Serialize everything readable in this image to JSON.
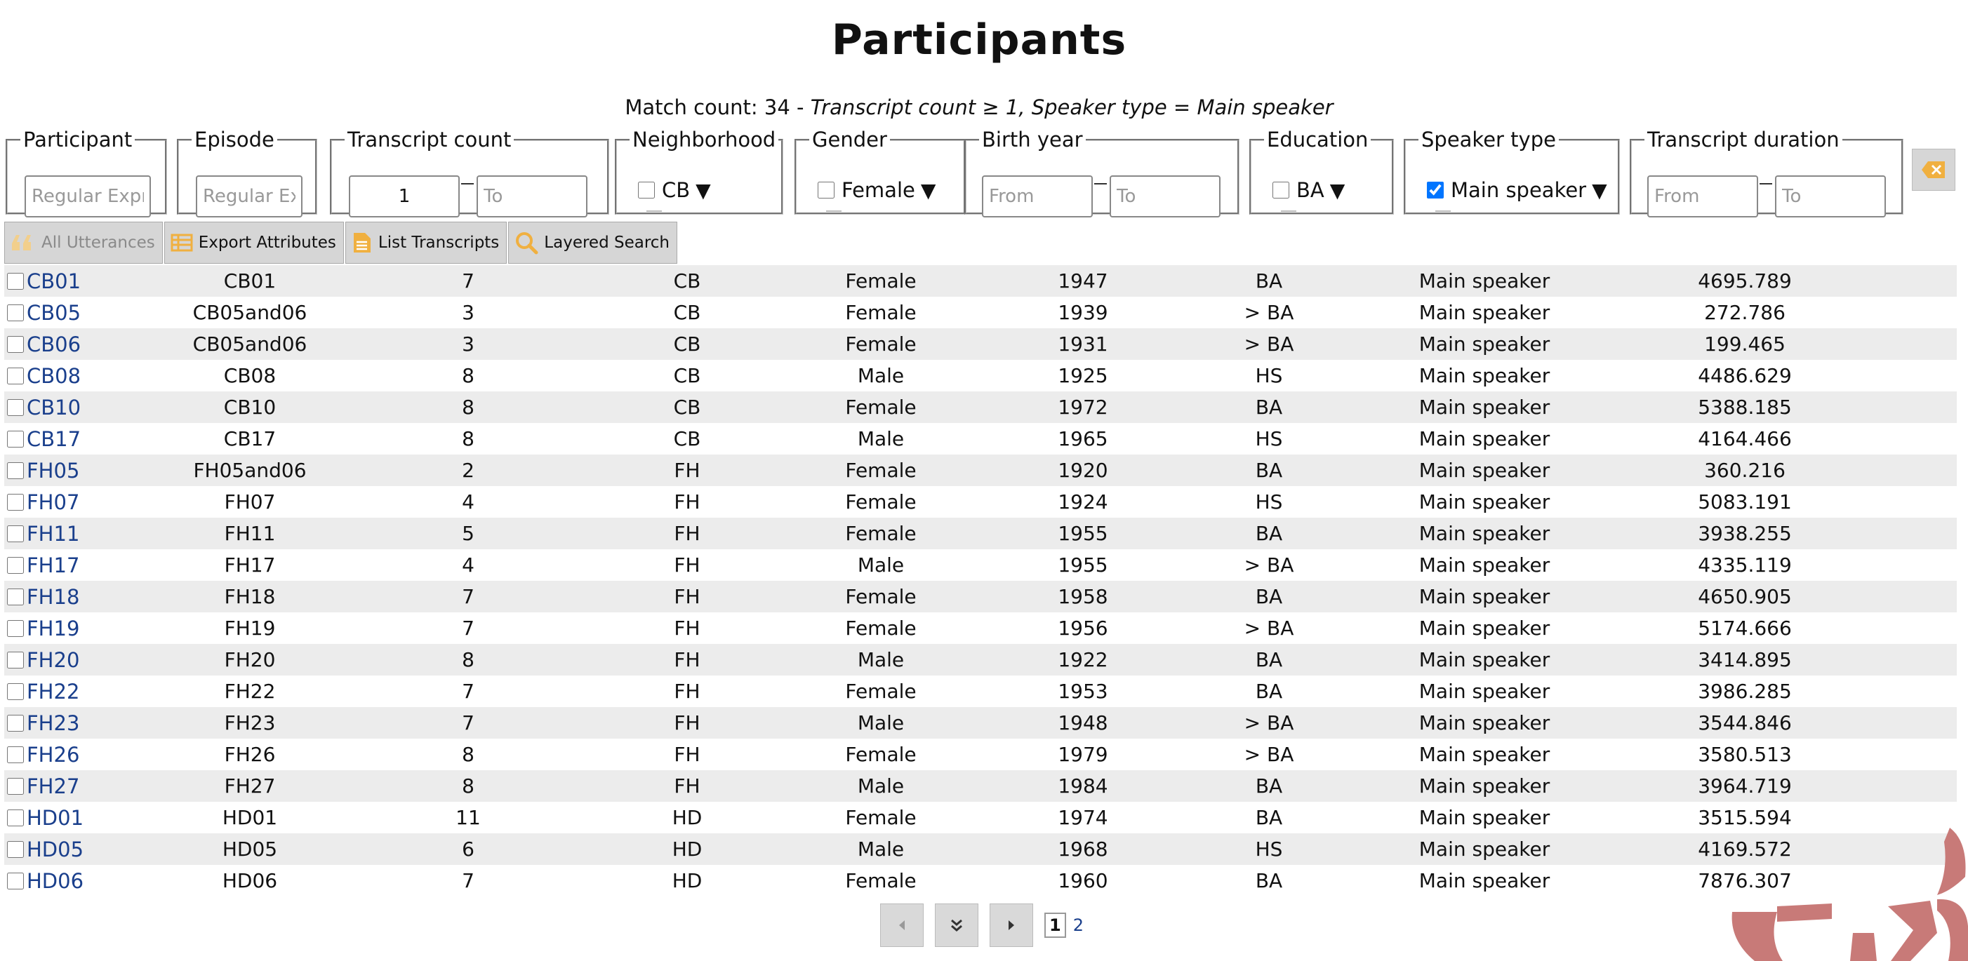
{
  "page": {
    "title": "Participants"
  },
  "match": {
    "prefix": "Match count: 34 - ",
    "criteria": "Transcript count ≥ 1, Speaker type = Main speaker"
  },
  "filters": {
    "participant": {
      "legend": "Participant",
      "placeholder": "Regular Expression"
    },
    "episode": {
      "legend": "Episode",
      "placeholder": "Regular Expression"
    },
    "transcript_count": {
      "legend": "Transcript count",
      "from_value": "1",
      "to_placeholder": "To"
    },
    "neighborhood": {
      "legend": "Neighborhood",
      "option": "CB",
      "checked": false,
      "arrow": "▼"
    },
    "gender": {
      "legend": "Gender",
      "option": "Female",
      "checked": false,
      "arrow": "▼"
    },
    "birth_year": {
      "legend": "Birth year",
      "from_placeholder": "From",
      "to_placeholder": "To"
    },
    "education": {
      "legend": "Education",
      "option": "BA",
      "checked": false,
      "arrow": "▼"
    },
    "speaker_type": {
      "legend": "Speaker type",
      "option": "Main speaker",
      "checked": true,
      "arrow": "▼"
    },
    "transcript_duration": {
      "legend": "Transcript duration",
      "from_placeholder": "From",
      "to_placeholder": "To"
    }
  },
  "toolbar": {
    "all_utterances": "All Utterances",
    "export_attributes": "Export Attributes",
    "list_transcripts": "List Transcripts",
    "layered_search": "Layered Search"
  },
  "rows": [
    [
      "CB01",
      "CB01",
      "7",
      "CB",
      "Female",
      "1947",
      "BA",
      "Main speaker",
      "4695.789"
    ],
    [
      "CB05",
      "CB05and06",
      "3",
      "CB",
      "Female",
      "1939",
      "> BA",
      "Main speaker",
      "272.786"
    ],
    [
      "CB06",
      "CB05and06",
      "3",
      "CB",
      "Female",
      "1931",
      "> BA",
      "Main speaker",
      "199.465"
    ],
    [
      "CB08",
      "CB08",
      "8",
      "CB",
      "Male",
      "1925",
      "HS",
      "Main speaker",
      "4486.629"
    ],
    [
      "CB10",
      "CB10",
      "8",
      "CB",
      "Female",
      "1972",
      "BA",
      "Main speaker",
      "5388.185"
    ],
    [
      "CB17",
      "CB17",
      "8",
      "CB",
      "Male",
      "1965",
      "HS",
      "Main speaker",
      "4164.466"
    ],
    [
      "FH05",
      "FH05and06",
      "2",
      "FH",
      "Female",
      "1920",
      "BA",
      "Main speaker",
      "360.216"
    ],
    [
      "FH07",
      "FH07",
      "4",
      "FH",
      "Female",
      "1924",
      "HS",
      "Main speaker",
      "5083.191"
    ],
    [
      "FH11",
      "FH11",
      "5",
      "FH",
      "Female",
      "1955",
      "BA",
      "Main speaker",
      "3938.255"
    ],
    [
      "FH17",
      "FH17",
      "4",
      "FH",
      "Male",
      "1955",
      "> BA",
      "Main speaker",
      "4335.119"
    ],
    [
      "FH18",
      "FH18",
      "7",
      "FH",
      "Female",
      "1958",
      "BA",
      "Main speaker",
      "4650.905"
    ],
    [
      "FH19",
      "FH19",
      "7",
      "FH",
      "Female",
      "1956",
      "> BA",
      "Main speaker",
      "5174.666"
    ],
    [
      "FH20",
      "FH20",
      "8",
      "FH",
      "Male",
      "1922",
      "BA",
      "Main speaker",
      "3414.895"
    ],
    [
      "FH22",
      "FH22",
      "7",
      "FH",
      "Female",
      "1953",
      "BA",
      "Main speaker",
      "3986.285"
    ],
    [
      "FH23",
      "FH23",
      "7",
      "FH",
      "Male",
      "1948",
      "> BA",
      "Main speaker",
      "3544.846"
    ],
    [
      "FH26",
      "FH26",
      "8",
      "FH",
      "Female",
      "1979",
      "> BA",
      "Main speaker",
      "3580.513"
    ],
    [
      "FH27",
      "FH27",
      "8",
      "FH",
      "Male",
      "1984",
      "BA",
      "Main speaker",
      "3964.719"
    ],
    [
      "HD01",
      "HD01",
      "11",
      "HD",
      "Female",
      "1974",
      "BA",
      "Main speaker",
      "3515.594"
    ],
    [
      "HD05",
      "HD05",
      "6",
      "HD",
      "Male",
      "1968",
      "HS",
      "Main speaker",
      "4169.572"
    ],
    [
      "HD06",
      "HD06",
      "7",
      "HD",
      "Female",
      "1960",
      "BA",
      "Main speaker",
      "7876.307"
    ]
  ],
  "pagination": {
    "current": "1",
    "next": "2"
  },
  "colors": {
    "accent": "#f0b040",
    "link": "#1a3f8c",
    "checked": "#1a6fe0",
    "logo": "#c87a78"
  },
  "icons": [
    "quote-icon",
    "table-icon",
    "document-icon",
    "magnifier-icon",
    "eraser-icon",
    "arrow-left-icon",
    "double-chevron-down-icon",
    "arrow-right-icon"
  ]
}
